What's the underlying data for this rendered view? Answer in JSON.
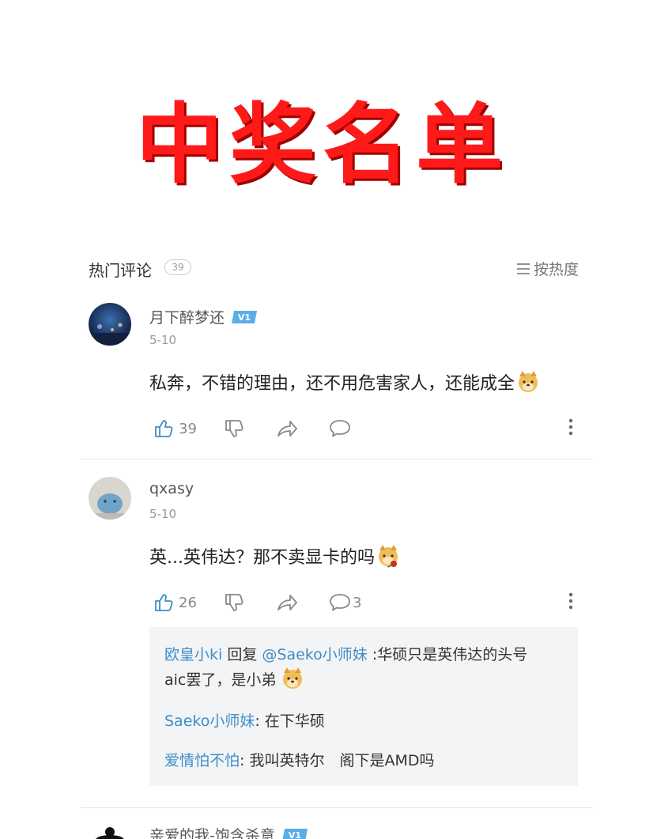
{
  "banner": {
    "title": "中奖名单"
  },
  "section": {
    "title": "热门评论",
    "count": "39",
    "sort_label": "按热度"
  },
  "comments": [
    {
      "user": "月下醉梦还",
      "vip": "V1",
      "date": "5-10",
      "text": "私奔，不错的理由，还不用危害家人，还能成全",
      "emoji": "doge-icon",
      "likes": "39",
      "reply_count": ""
    },
    {
      "user": "qxasy",
      "vip": "",
      "date": "5-10",
      "text": "英...英伟达？那不卖显卡的吗",
      "emoji": "doge-rose-icon",
      "likes": "26",
      "reply_count": "3"
    },
    {
      "user": "亲爱的我-饱含杀意",
      "vip": "V1"
    }
  ],
  "replies": [
    {
      "user": "欧皇小ki",
      "reply_word": "回复",
      "target": "@Saeko小师妹",
      "text_line1": ":华硕只是英伟达的头号",
      "text_line2": "aic罢了，是小弟"
    },
    {
      "user": "Saeko小师妹",
      "text": ": 在下华硕"
    },
    {
      "user": "爱情怕不怕",
      "text": ": 我叫英特尔　阁下是AMD吗"
    }
  ],
  "colors": {
    "accent": "#3f8ec9",
    "banner_red": "#ff1a1a",
    "vip_blue": "#5aaee6"
  }
}
